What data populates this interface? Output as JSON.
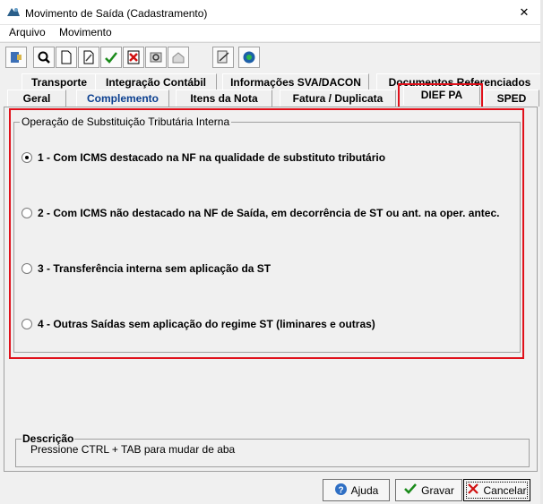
{
  "window": {
    "title": "Movimento de Saída (Cadastramento)",
    "close_glyph": "✕",
    "icon": "app-logo-icon"
  },
  "menu": {
    "items": [
      "Arquivo",
      "Movimento"
    ]
  },
  "toolbar": {
    "buttons": [
      "exit-icon",
      "search-icon",
      "new-document-icon",
      "edit-document-icon",
      "confirm-check-icon",
      "delete-icon",
      "refresh-icon",
      "print-icon",
      "calculator-icon",
      "nfe-icon"
    ]
  },
  "tabs": {
    "row1": [
      "Transporte",
      "Integração Contábil",
      "Informações SVA/DACON",
      "Documentos Referenciados"
    ],
    "row2": [
      "Geral",
      "Complemento",
      "Itens da Nota",
      "Fatura / Duplicata",
      "DIEF PA",
      "SPED"
    ],
    "selected": "DIEF PA"
  },
  "group": {
    "title": "Operação de Substituição Tributária Interna",
    "options": [
      {
        "label": "1 - Com ICMS destacado na NF na qualidade de substituto tributário",
        "checked": true
      },
      {
        "label": "2 - Com ICMS não destacado na NF de Saída, em decorrência de ST ou ant. na oper. antec.",
        "checked": false
      },
      {
        "label": "3 - Transferência interna sem aplicação da ST",
        "checked": false
      },
      {
        "label": "4 - Outras Saídas sem aplicação do regime ST (liminares e outras)",
        "checked": false
      }
    ]
  },
  "description": {
    "title": "Descrição",
    "text": "Pressione CTRL + TAB para  mudar de aba"
  },
  "buttons": {
    "help": "Ajuda",
    "save": "Gravar",
    "cancel": "Cancelar"
  },
  "colors": {
    "highlight": "#e0101a",
    "active_tab_text": "#0b3f8f"
  }
}
